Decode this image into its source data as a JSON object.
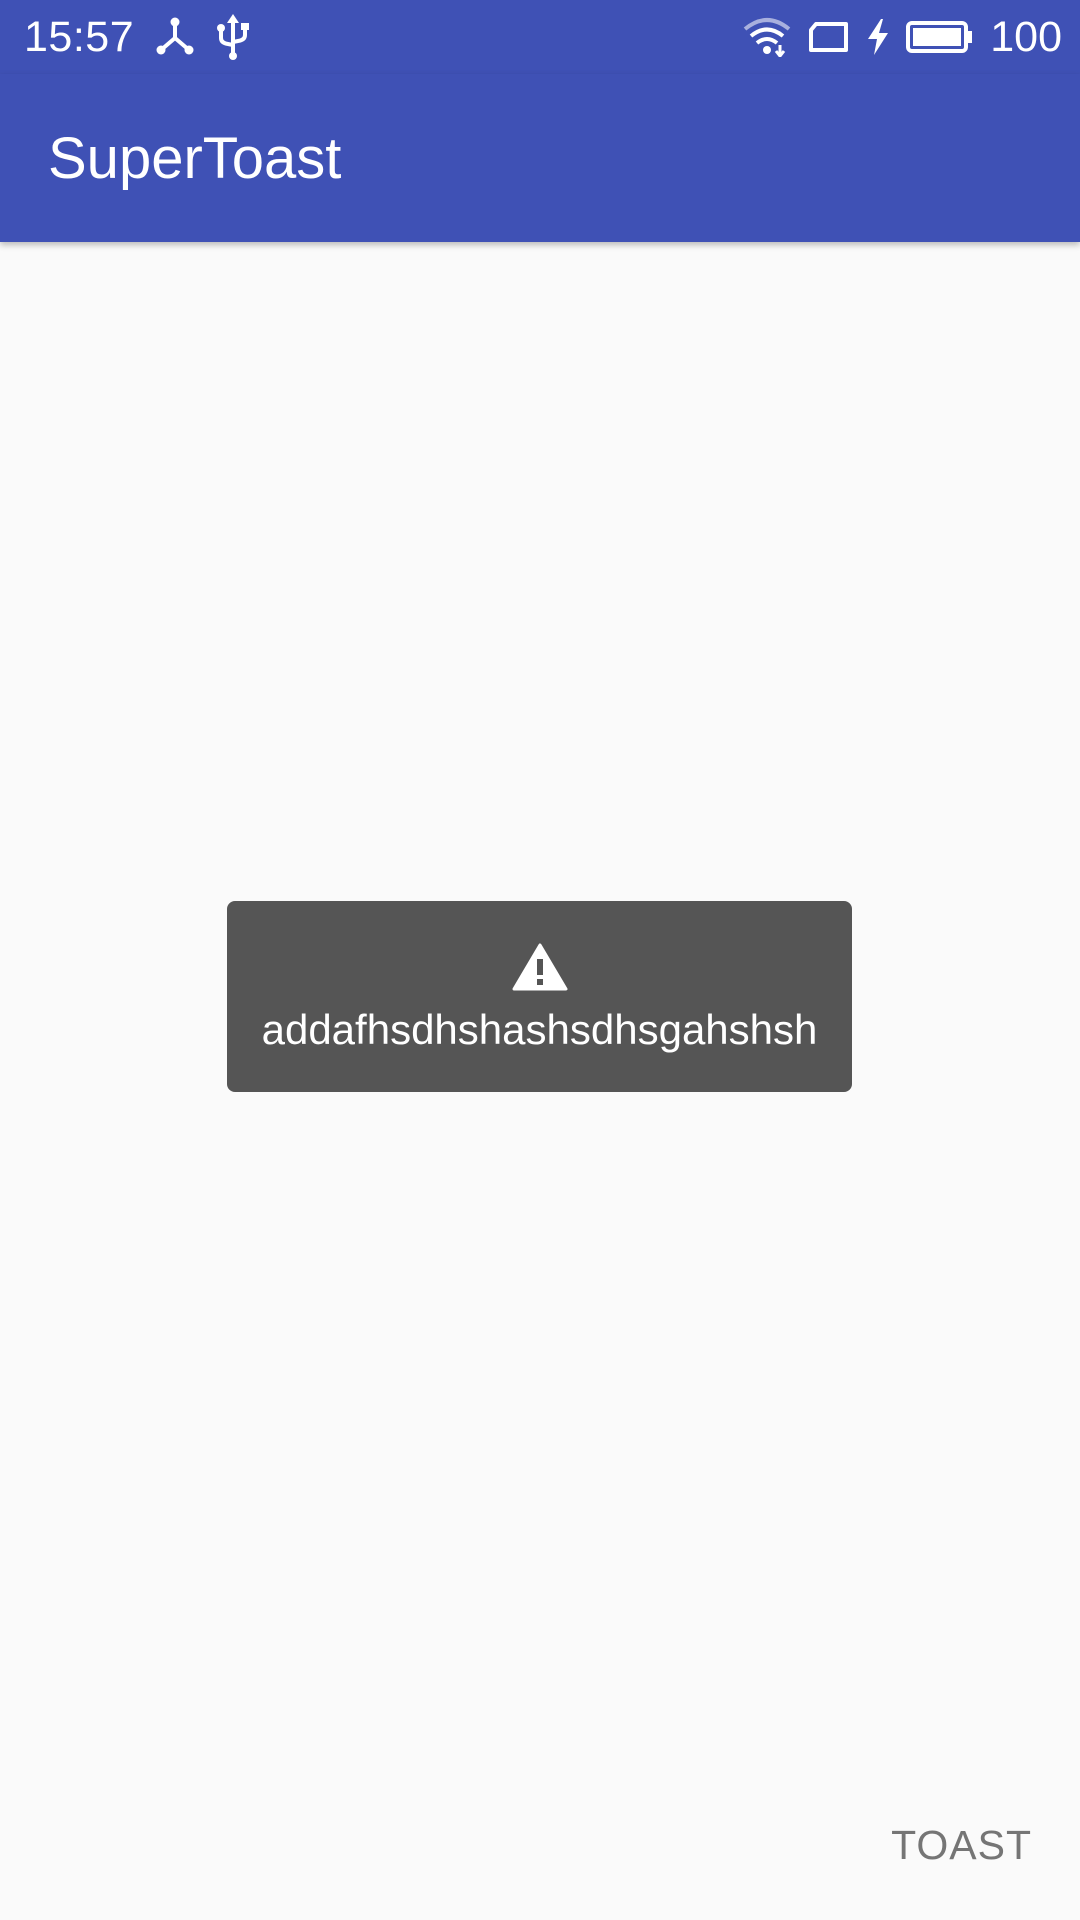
{
  "status_bar": {
    "time": "15:57",
    "battery_level": "100",
    "left_icons": [
      "usb-tether-icon",
      "usb-icon"
    ],
    "right_icons": [
      "wifi-icon",
      "sim-card-icon",
      "charging-bolt-icon",
      "battery-icon"
    ]
  },
  "app_bar": {
    "title": "SuperToast",
    "color": "#3f51b5"
  },
  "toast": {
    "icon": "warning-icon",
    "message": "addafhsdhshashsdhsgahshsh",
    "background": "#555555"
  },
  "main": {
    "toast_button_label": "TOAST"
  }
}
